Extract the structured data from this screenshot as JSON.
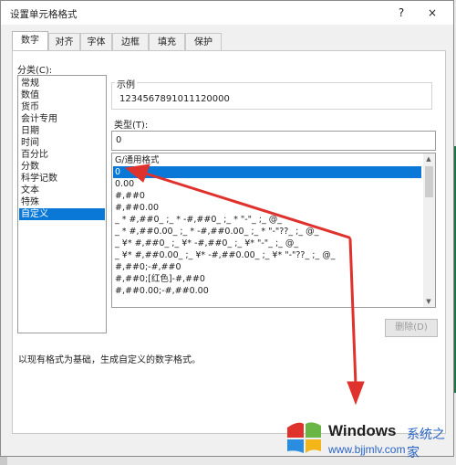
{
  "dialog": {
    "title": "设置单元格格式",
    "help_btn": "?",
    "close_btn": "×"
  },
  "tabs": [
    "数字",
    "对齐",
    "字体",
    "边框",
    "填充",
    "保护"
  ],
  "category": {
    "label": "分类(C):",
    "items": [
      "常规",
      "数值",
      "货币",
      "会计专用",
      "日期",
      "时间",
      "百分比",
      "分数",
      "科学记数",
      "文本",
      "特殊",
      "自定义"
    ],
    "selected_index": 11
  },
  "sample": {
    "label": "示例",
    "value": "1234567891011120000"
  },
  "type": {
    "label": "类型(T):",
    "value": "0",
    "items": [
      "G/通用格式",
      "0",
      "0.00",
      "#,##0",
      "#,##0.00",
      "_ * #,##0_ ;_ * -#,##0_ ;_ * \"-\"_ ;_ @_",
      "_ * #,##0.00_ ;_ * -#,##0.00_ ;_ * \"-\"??_ ;_ @_",
      "_ ¥* #,##0_ ;_ ¥* -#,##0_ ;_ ¥* \"-\"_ ;_ @_",
      "_ ¥* #,##0.00_ ;_ ¥* -#,##0.00_ ;_ ¥* \"-\"??_ ;_ @_",
      "#,##0;-#,##0",
      "#,##0;[红色]-#,##0",
      "#,##0.00;-#,##0.00"
    ],
    "selected_index": 1
  },
  "delete_button": "删除(D)",
  "description": "以现有格式为基础，生成自定义的数字格式。",
  "watermark": {
    "brand": "Windows",
    "brand_cn": "系统之家",
    "url": "www.bjjmlv.com"
  },
  "colors": {
    "selection": "#0a78d7",
    "arrow": "#e0322d",
    "excel_green": "#207245"
  },
  "icons": {
    "scroll_up": "chevron-up-icon",
    "scroll_down": "chevron-down-icon",
    "watermark_logo": "windows-logo-icon",
    "annotation": "red-arrow-annotation"
  }
}
